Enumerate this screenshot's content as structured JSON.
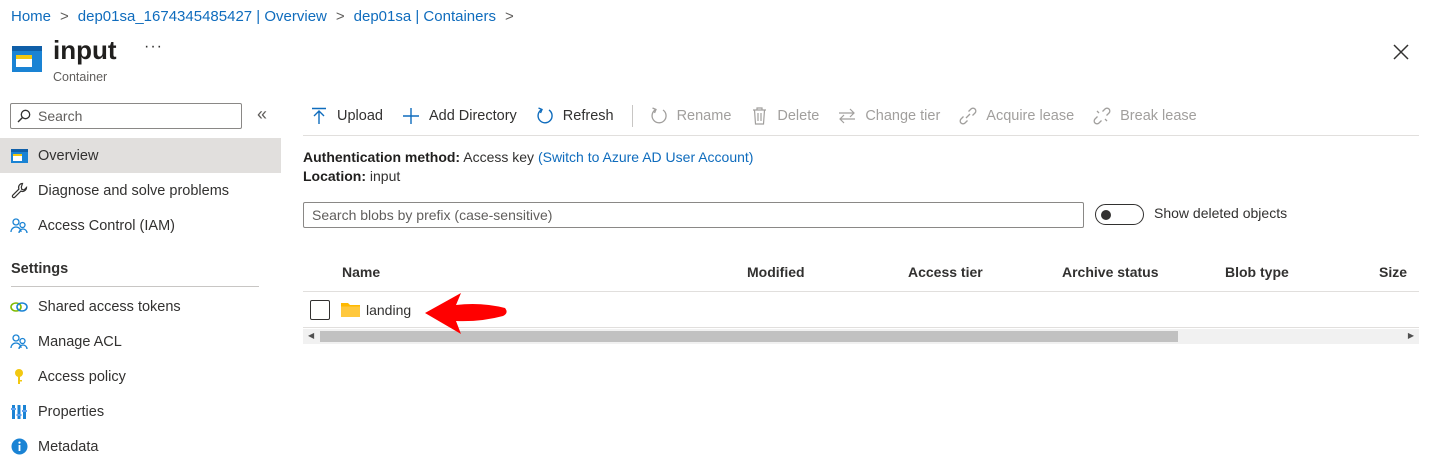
{
  "breadcrumb": [
    "Home",
    "dep01sa_1674345485427 | Overview",
    "dep01sa | Containers"
  ],
  "header": {
    "title": "input",
    "subtitle": "Container",
    "more": "···"
  },
  "sidebar": {
    "search_placeholder": "Search",
    "collapse": "«",
    "items": [
      {
        "label": "Overview",
        "icon": "container-icon"
      },
      {
        "label": "Diagnose and solve problems",
        "icon": "wrench-icon"
      },
      {
        "label": "Access Control (IAM)",
        "icon": "people-icon"
      }
    ],
    "settings_label": "Settings",
    "settings_items": [
      {
        "label": "Shared access tokens",
        "icon": "link-icon"
      },
      {
        "label": "Manage ACL",
        "icon": "people-icon"
      },
      {
        "label": "Access policy",
        "icon": "key-icon"
      },
      {
        "label": "Properties",
        "icon": "properties-icon"
      },
      {
        "label": "Metadata",
        "icon": "info-icon"
      }
    ]
  },
  "toolbar": {
    "upload": "Upload",
    "add_directory": "Add Directory",
    "refresh": "Refresh",
    "rename": "Rename",
    "delete": "Delete",
    "change_tier": "Change tier",
    "acquire_lease": "Acquire lease",
    "break_lease": "Break lease"
  },
  "info": {
    "auth_label": "Authentication method:",
    "auth_value": "Access key",
    "auth_link": "(Switch to Azure AD User Account)",
    "location_label": "Location:",
    "location_value": "input"
  },
  "blob_search": {
    "placeholder": "Search blobs by prefix (case-sensitive)"
  },
  "show_deleted": {
    "label": "Show deleted objects",
    "on": false
  },
  "table": {
    "columns": [
      "Name",
      "Modified",
      "Access tier",
      "Archive status",
      "Blob type",
      "Size"
    ],
    "rows": [
      {
        "name": "landing",
        "type": "folder",
        "modified": "",
        "access_tier": "",
        "archive_status": "",
        "blob_type": "",
        "size": ""
      }
    ]
  },
  "colors": {
    "link": "#0f6cbd",
    "folder": "#ffb900",
    "annotation_arrow": "#ff0000",
    "active_nav": "#e1dfdd"
  }
}
